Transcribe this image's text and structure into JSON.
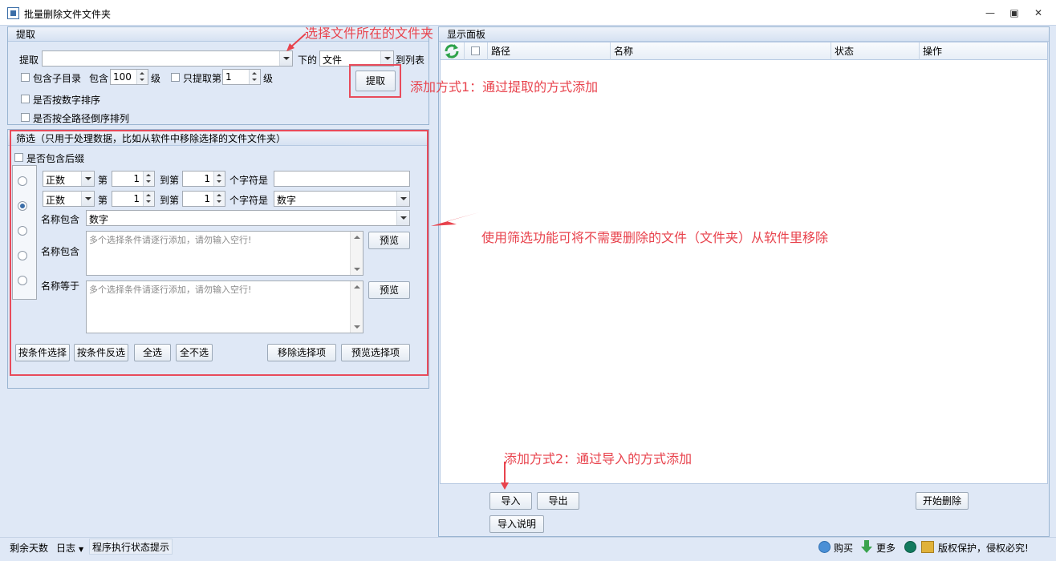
{
  "window": {
    "title": "批量删除文件文件夹"
  },
  "extract": {
    "header": "提取",
    "label_extract": "提取",
    "path_value": "",
    "label_under": "下的",
    "type_value": "文件",
    "label_to_list": "到列表",
    "include_sub_label": "包含子目录",
    "include_label": "包含",
    "levels_value": "100",
    "level_unit": "级",
    "only_extract_label": "只提取第",
    "only_level_value": "1",
    "only_level_unit": "级",
    "extract_button": "提取",
    "sort_numeric_label": "是否按数字排序",
    "sort_fullpath_label": "是否按全路径倒序排列"
  },
  "filter": {
    "header": "筛选（只用于处理数据，比如从软件中移除选择的文件文件夹）",
    "include_suffix_label": "是否包含后缀",
    "row1": {
      "mode": "正数",
      "label_nth": "第",
      "from": "1",
      "label_to_nth": "到第",
      "to": "1",
      "label_chars_are": "个字符是",
      "value": ""
    },
    "row2": {
      "mode": "正数",
      "label_nth": "第",
      "from": "1",
      "label_to_nth": "到第",
      "to": "1",
      "label_chars_are": "个字符是",
      "value": "数字"
    },
    "name_contains_label": "名称包含",
    "name_contains_value": "数字",
    "name_contains2_label": "名称包含",
    "name_contains2_placeholder": "多个选择条件请逐行添加，请勿输入空行!",
    "name_equals_label": "名称等于",
    "name_equals_placeholder": "多个选择条件请逐行添加，请勿输入空行!",
    "preview_button_1": "预览",
    "preview_button_2": "预览",
    "btn_select_by_cond": "按条件选择",
    "btn_invert_by_cond": "按条件反选",
    "btn_select_all": "全选",
    "btn_select_none": "全不选",
    "btn_remove_selected": "移除选择项",
    "btn_preview_selected": "预览选择项"
  },
  "display": {
    "header": "显示面板",
    "columns": [
      "路径",
      "名称",
      "状态",
      "操作"
    ],
    "btn_import": "导入",
    "btn_export": "导出",
    "btn_start_delete": "开始删除",
    "btn_import_help": "导入说明"
  },
  "status": {
    "days_left": "剩余天数",
    "log": "日志",
    "state_hint": "程序执行状态提示",
    "buy": "购买",
    "more": "更多",
    "copyright": "版权保护，侵权必究!"
  },
  "annotations": {
    "a1": "选择文件所在的文件夹",
    "a2": "添加方式1：通过提取的方式添加",
    "a3": "使用筛选功能可将不需要删除的文件（文件夹）从软件里移除",
    "a4": "添加方式2：通过导入的方式添加"
  },
  "colors": {
    "annotation": "#e8434d",
    "panel_bg": "#dfe8f6",
    "border": "#99b4d1"
  }
}
